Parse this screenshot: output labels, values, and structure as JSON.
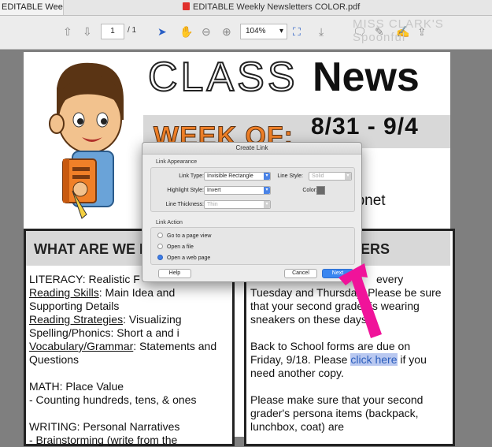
{
  "window": {
    "tab_label": "EDITABLE Weekly...",
    "title": "EDITABLE Weekly Newsletters COLOR.pdf"
  },
  "toolbar": {
    "page_current": "1",
    "page_total": "/ 1",
    "zoom": "104%",
    "icons": [
      "arrow-up-icon",
      "arrow-down-icon",
      "pointer-icon",
      "hand-icon",
      "zoom-out-icon",
      "zoom-in-icon",
      "fit-page-icon",
      "download-icon",
      "comment-icon",
      "pen-icon",
      "sign-icon",
      "share-icon"
    ]
  },
  "watermark": "MISS CLARK'S Spoonful",
  "newsletter": {
    "title_class": "CLASS",
    "title_news": "News",
    "week_of": "WEEK OF:",
    "dates": "8/31 - 9/4",
    "webnet_text": "ebnet",
    "left_header": "WHAT ARE WE L",
    "right_header": "ERS",
    "literacy_label": "LITERACY",
    "literacy_value": ": Realistic F",
    "reading_skills_label": "Reading Skills",
    "reading_skills_value": ": Main Idea and Supporting Details",
    "reading_strategies_label": "Reading Strategies",
    "reading_strategies_value": ": Visualizing",
    "spelling": "Spelling/Phonics: Short a and i",
    "vocab_label": "Vocabulary/Grammar",
    "vocab_value": ": Statements and Questions",
    "math_label": "MATH",
    "math_value": ": Place Value",
    "math_item": "- Counting hundreds, tens, & ones",
    "writing_label": "WRITING",
    "writing_value": ": Personal Narratives",
    "writing_item": "- Brainstorming (write from the",
    "right_p1_a": "every",
    "right_p1_b": "Tuesday and Thursday. Please be sure that your second grader is wearing sneakers on these days.",
    "right_p2_a": "Back to School forms are due on Friday, 9/18. Please ",
    "right_p2_link": "click here",
    "right_p2_b": " if you need another copy.",
    "right_p3": "Please make sure that your second grader's persona items (backpack, lunchbox, coat) are"
  },
  "dialog": {
    "title": "Create Link",
    "appearance_group": "Link Appearance",
    "link_type_label": "Link Type:",
    "link_type_value": "Invisible Rectangle",
    "line_style_label": "Line Style:",
    "line_style_value": "Solid",
    "highlight_style_label": "Highlight Style:",
    "highlight_style_value": "Invert",
    "color_label": "Color:",
    "line_thickness_label": "Line Thickness:",
    "line_thickness_value": "Thin",
    "action_group": "Link Action",
    "option_page_view": "Go to a page view",
    "option_open_file": "Open a file",
    "option_web_page": "Open a web page",
    "selected_option": "Open a web page",
    "help_button": "Help",
    "cancel_button": "Cancel",
    "next_button": "Next"
  },
  "colors": {
    "accent_arrow": "#f0139a",
    "week_orange": "#f08028",
    "primary_button": "#3a86f0"
  }
}
